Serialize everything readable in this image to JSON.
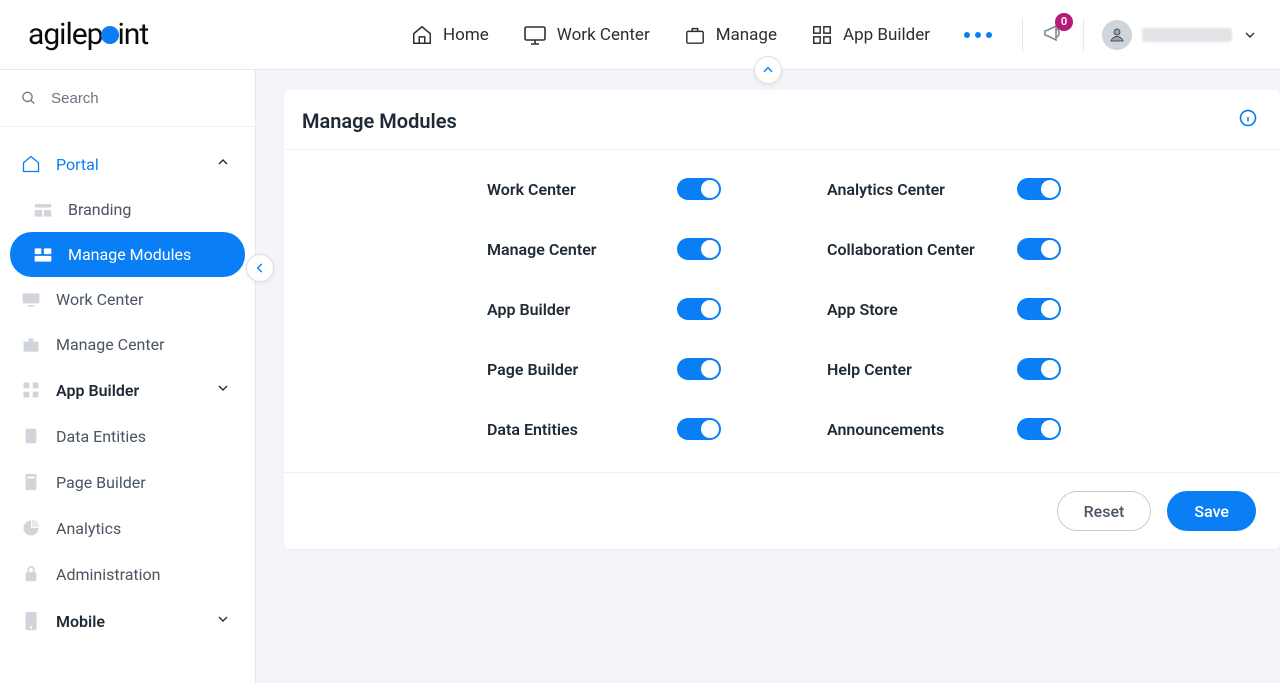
{
  "brand": "agilepoint",
  "topnav": {
    "home": "Home",
    "work_center": "Work Center",
    "manage": "Manage",
    "app_builder": "App Builder"
  },
  "notifications": {
    "count": "0"
  },
  "search": {
    "placeholder": "Search"
  },
  "sidebar": {
    "items": [
      {
        "label": "Portal",
        "expanded": true,
        "selected": true
      },
      {
        "label": "Branding"
      },
      {
        "label": "Manage Modules",
        "active": true
      },
      {
        "label": "Work Center"
      },
      {
        "label": "Manage Center"
      },
      {
        "label": "App Builder",
        "expandable": true
      },
      {
        "label": "Data Entities"
      },
      {
        "label": "Page Builder"
      },
      {
        "label": "Analytics"
      },
      {
        "label": "Administration"
      },
      {
        "label": "Mobile",
        "expandable": true
      }
    ]
  },
  "page": {
    "title": "Manage Modules",
    "modules_col1": [
      {
        "label": "Work Center",
        "enabled": true
      },
      {
        "label": "Manage Center",
        "enabled": true
      },
      {
        "label": "App Builder",
        "enabled": true
      },
      {
        "label": "Page Builder",
        "enabled": true
      },
      {
        "label": "Data Entities",
        "enabled": true
      }
    ],
    "modules_col2": [
      {
        "label": "Analytics Center",
        "enabled": true
      },
      {
        "label": "Collaboration Center",
        "enabled": true
      },
      {
        "label": "App Store",
        "enabled": true
      },
      {
        "label": "Help Center",
        "enabled": true
      },
      {
        "label": "Announcements",
        "enabled": true
      }
    ],
    "actions": {
      "reset": "Reset",
      "save": "Save"
    }
  }
}
